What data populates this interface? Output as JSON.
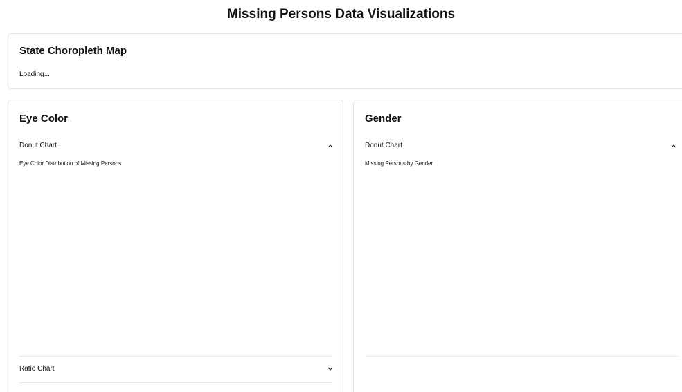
{
  "header": {
    "title": "Missing Persons Data Visualizations"
  },
  "map_section": {
    "title": "State Choropleth Map",
    "status": "Loading..."
  },
  "eye_color_section": {
    "title": "Eye Color",
    "donut_accordion": {
      "label": "Donut Chart",
      "state": "expanded",
      "chart_title": "Eye Color Distribution of Missing Persons"
    },
    "ratio_accordion": {
      "label": "Ratio Chart",
      "state": "collapsed"
    }
  },
  "gender_section": {
    "title": "Gender",
    "donut_accordion": {
      "label": "Donut Chart",
      "state": "expanded",
      "chart_title": "Missing Persons by Gender"
    }
  },
  "icons": {
    "expanded": "chevron-up-icon",
    "collapsed": "chevron-down-icon"
  }
}
